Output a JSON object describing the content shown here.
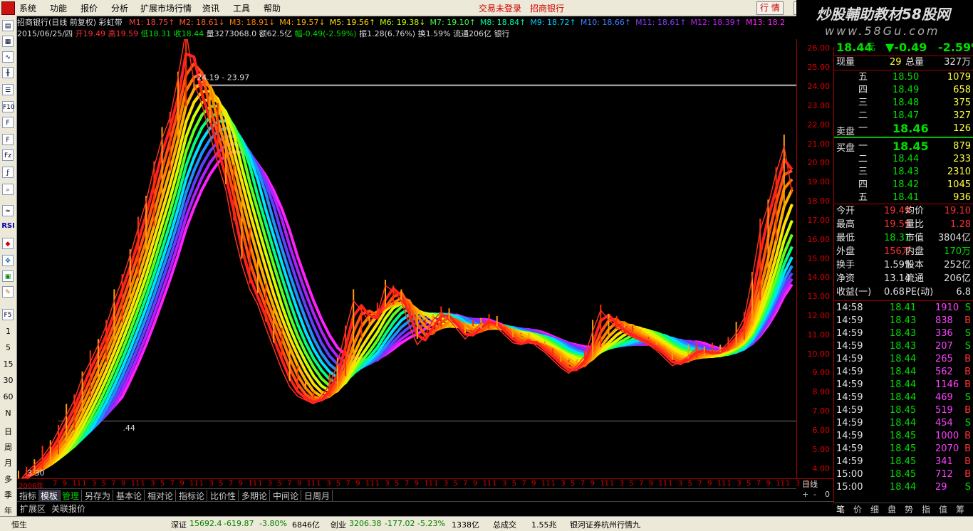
{
  "menubar": {
    "items": [
      "系统",
      "功能",
      "报价",
      "分析",
      "扩展市场行情",
      "资讯",
      "工具",
      "帮助"
    ],
    "trade_status": "交易未登录",
    "stock_name": "招商银行",
    "btn_quote": "行 情",
    "btn_info": "资"
  },
  "brand": {
    "line1": "炒股輔助教材58股网",
    "line2": "www.58Gu.com"
  },
  "lefttoolbar": {
    "top_icons": [
      "doc-icon",
      "grid-icon",
      "line-chart-icon",
      "kline-icon",
      "table-icon",
      "f10-icon",
      "f-icon",
      "f-icon",
      "fiz-icon",
      "zoom-icon",
      "search-icon",
      "wave-icon"
    ],
    "rsi": "RSI",
    "bottom_items": [
      "F5",
      "1",
      "5",
      "15",
      "30",
      "60",
      "N",
      "日",
      "周",
      "月",
      "多",
      "季",
      "年"
    ]
  },
  "header": {
    "title": "招商银行(日线 前复权) 彩虹带",
    "ma": [
      {
        "label": "M1: 18.75",
        "arrow": "↑"
      },
      {
        "label": "M2: 18.61",
        "arrow": "↓"
      },
      {
        "label": "M3: 18.91",
        "arrow": "↓"
      },
      {
        "label": "M4: 19.57",
        "arrow": "↓"
      },
      {
        "label": "M5: 19.56",
        "arrow": "↑"
      },
      {
        "label": "M6: 19.38",
        "arrow": "↓"
      },
      {
        "label": "M7: 19.10",
        "arrow": "↑"
      },
      {
        "label": "M8: 18.84",
        "arrow": "↑"
      },
      {
        "label": "M9: 18.72",
        "arrow": "↑"
      },
      {
        "label": "M10: 18.66",
        "arrow": "↑"
      },
      {
        "label": "M11: 18.61",
        "arrow": "↑"
      },
      {
        "label": "M12: 18.39",
        "arrow": "↑"
      },
      {
        "label": "M13: 18.2",
        "arrow": ""
      }
    ],
    "line2": {
      "date": "2015/06/25/四",
      "open": "开19.49",
      "high": "高19.59",
      "low": "低18.31",
      "close": "收18.44",
      "vol": "量3273068.0",
      "amount": "额62.5亿",
      "change": "幅-0.49(-2.59%)",
      "amp": "振1.28(6.76%)",
      "turn": "换1.59%",
      "float": "流通206亿",
      "industry": "银行"
    }
  },
  "chart_data": {
    "type": "line",
    "title": "招商银行(日线 前复权) 彩虹带",
    "xlabel": "",
    "ylabel": "",
    "ylim": [
      3.5,
      26.5
    ],
    "yticks": [
      4,
      5,
      6,
      7,
      8,
      9,
      10,
      11,
      12,
      13,
      14,
      15,
      16,
      17,
      18,
      19,
      20,
      21,
      22,
      23,
      24,
      25,
      26
    ],
    "annotations": [
      {
        "text": "26.95",
        "kind": "high"
      },
      {
        "text": "24.19 - 23.97",
        "kind": "range"
      },
      {
        "text": "3.30",
        "kind": "low"
      },
      {
        "text": ".44",
        "kind": "label"
      }
    ],
    "hlines": [
      24.08,
      6.5
    ],
    "x_start_label": "2006年",
    "x_month_labels": [
      "7",
      "9",
      "11",
      "1",
      "3",
      "5",
      "7",
      "9",
      "11",
      "1",
      "3",
      "5",
      "7",
      "9",
      "11",
      "1",
      "3",
      "5",
      "7",
      "9",
      "11",
      "1",
      "3",
      "5",
      "7",
      "9",
      "11",
      "1",
      "3",
      "5",
      "7",
      "9",
      "11",
      "1",
      "3",
      "5",
      "7",
      "9",
      "11",
      "1",
      "3",
      "5",
      "7",
      "9",
      "11",
      "1",
      "3",
      "5",
      "7",
      "9",
      "11",
      "1",
      "3",
      "5",
      "7",
      "9",
      "11",
      "1",
      "3",
      "5",
      "7",
      "9",
      "11",
      "1",
      "3",
      "5",
      "7",
      "9",
      "11",
      "1",
      "3",
      "5",
      "7",
      "9",
      "11",
      "1",
      "3",
      "5"
    ],
    "price_path": [
      3.3,
      3.8,
      4.2,
      4.6,
      5.2,
      6.0,
      6.8,
      7.6,
      8.8,
      9.6,
      10.5,
      11.5,
      12.8,
      13.9,
      15.2,
      16.6,
      18.0,
      19.8,
      21.3,
      22.4,
      24.5,
      26.95,
      24.2,
      23.1,
      21.5,
      20.0,
      18.6,
      16.4,
      14.7,
      13.4,
      12.6,
      11.4,
      10.3,
      9.2,
      8.3,
      7.8,
      7.6,
      7.4,
      7.8,
      8.4,
      9.5,
      11.2,
      12.8,
      12.3,
      11.7,
      12.1,
      13.6,
      13.3,
      12.8,
      11.5,
      10.5,
      11.0,
      11.8,
      12.2,
      11.8,
      11.3,
      10.8,
      11.2,
      11.6,
      11.8,
      11.4,
      11.0,
      10.6,
      10.5,
      10.8,
      10.4,
      10.1,
      9.7,
      9.3,
      9.0,
      9.4,
      9.9,
      11.2,
      12.3,
      11.8,
      11.4,
      11.1,
      10.9,
      10.7,
      10.5,
      10.2,
      9.8,
      9.4,
      9.6,
      9.9,
      10.3,
      10.1,
      10.0,
      10.2,
      10.6,
      11.1,
      11.9,
      14.0,
      16.5,
      17.8,
      19.5,
      20.9,
      18.44
    ],
    "ribbon_bands": 13,
    "series_names": [
      "M1",
      "M2",
      "M3",
      "M4",
      "M5",
      "M6",
      "M7",
      "M8",
      "M9",
      "M10",
      "M11",
      "M12",
      "M13"
    ]
  },
  "tabs": [
    "指标",
    "模板",
    "管理",
    "另存为",
    "基本论",
    "相对论",
    "指标论",
    "比价性",
    "多期论",
    "中间论",
    "日周月"
  ],
  "period": "日线",
  "period_controls": [
    "+",
    "-",
    "0"
  ],
  "subtabs": [
    "扩展区",
    "关联报价"
  ],
  "quote": {
    "price": "18.44",
    "price_unit": "元",
    "change": "▼-0.49",
    "pct": "-2.59%",
    "now_vol_label": "现量",
    "now_vol": "29",
    "total_vol_label": "总量",
    "total_vol": "327万",
    "asks": [
      {
        "lv": "五",
        "p": "18.50",
        "v": "1079"
      },
      {
        "lv": "四",
        "p": "18.49",
        "v": "658"
      },
      {
        "lv": "三",
        "p": "18.48",
        "v": "375"
      },
      {
        "lv": "二",
        "p": "18.47",
        "v": "327"
      },
      {
        "lv": "一",
        "p": "18.46",
        "v": "126",
        "big": true
      }
    ],
    "ask_label": "卖盘",
    "bid_label": "买盘",
    "bids": [
      {
        "lv": "一",
        "p": "18.45",
        "v": "879",
        "big": true
      },
      {
        "lv": "二",
        "p": "18.44",
        "v": "233"
      },
      {
        "lv": "三",
        "p": "18.43",
        "v": "2310"
      },
      {
        "lv": "四",
        "p": "18.42",
        "v": "1045"
      },
      {
        "lv": "五",
        "p": "18.41",
        "v": "936"
      }
    ],
    "stats": [
      {
        "k1": "今开",
        "v1": "19.49",
        "c1": "red",
        "k2": "均价",
        "v2": "19.10",
        "c2": "red"
      },
      {
        "k1": "最高",
        "v1": "19.59",
        "c1": "red",
        "k2": "量比",
        "v2": "1.28",
        "c2": "red"
      },
      {
        "k1": "最低",
        "v1": "18.31",
        "c1": "green",
        "k2": "市值",
        "v2": "3804亿",
        "c2": "white"
      },
      {
        "k1": "外盘",
        "v1": "156万",
        "c1": "red",
        "k2": "内盘",
        "v2": "170万",
        "c2": "green"
      },
      {
        "k1": "换手",
        "v1": "1.59%",
        "c1": "white",
        "k2": "股本",
        "v2": "252亿",
        "c2": "white"
      },
      {
        "k1": "净资",
        "v1": "13.14",
        "c1": "white",
        "k2": "流通",
        "v2": "206亿",
        "c2": "white"
      },
      {
        "k1": "收益(一)",
        "v1": "0.68",
        "c1": "white",
        "k2": "PE(动)",
        "v2": "6.8",
        "c2": "white"
      }
    ],
    "ticks": [
      {
        "t": "14:58",
        "p": "18.41",
        "v": "1910",
        "s": "S"
      },
      {
        "t": "14:59",
        "p": "18.43",
        "v": "838",
        "s": "B"
      },
      {
        "t": "14:59",
        "p": "18.43",
        "v": "336",
        "s": "S"
      },
      {
        "t": "14:59",
        "p": "18.43",
        "v": "207",
        "s": "S"
      },
      {
        "t": "14:59",
        "p": "18.44",
        "v": "265",
        "s": "B"
      },
      {
        "t": "14:59",
        "p": "18.44",
        "v": "562",
        "s": "B"
      },
      {
        "t": "14:59",
        "p": "18.44",
        "v": "1146",
        "s": "B"
      },
      {
        "t": "14:59",
        "p": "18.44",
        "v": "469",
        "s": "S"
      },
      {
        "t": "14:59",
        "p": "18.45",
        "v": "519",
        "s": "B"
      },
      {
        "t": "14:59",
        "p": "18.44",
        "v": "454",
        "s": "S"
      },
      {
        "t": "14:59",
        "p": "18.45",
        "v": "1000",
        "s": "B"
      },
      {
        "t": "14:59",
        "p": "18.45",
        "v": "2070",
        "s": "B"
      },
      {
        "t": "14:59",
        "p": "18.45",
        "v": "341",
        "s": "B"
      },
      {
        "t": "15:00",
        "p": "18.45",
        "v": "712",
        "s": "B"
      },
      {
        "t": "15:00",
        "p": "18.44",
        "v": "29",
        "s": "S"
      }
    ]
  },
  "right_tabs": [
    "笔",
    "价",
    "细",
    "盘",
    "势",
    "指",
    "值",
    "筹"
  ],
  "status": {
    "index1_name": "恒生",
    "sz_label": "深证",
    "sz_value": "15692.4",
    "sz_chg": "-619.87",
    "sz_pct": "-3.80%",
    "sz_amt": "6846亿",
    "cy_label": "创业",
    "cy_value": "3206.38",
    "cy_chg": "-177.02",
    "cy_pct": "-5.23%",
    "cy_amt": "1338亿",
    "total_label": "总成交",
    "total_value": "1.55兆",
    "server": "银河证券杭州行情九"
  },
  "colors": {
    "up": "#ff3030",
    "down": "#00dd00",
    "bg": "#000000",
    "axis": "#aa0000"
  }
}
